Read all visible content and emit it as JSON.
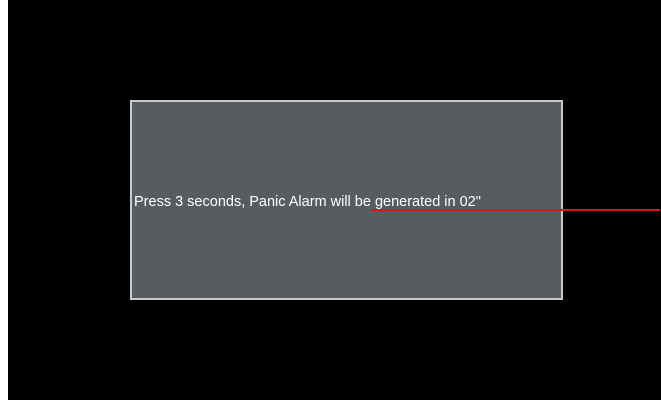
{
  "dialog": {
    "message": "Press 3 seconds, Panic Alarm will be generated in 02\""
  },
  "colors": {
    "screen_background": "#000000",
    "dialog_background": "#565c60",
    "dialog_border": "#c9cdd0",
    "message_text": "#ffffff",
    "callout_line": "#d9141c"
  }
}
